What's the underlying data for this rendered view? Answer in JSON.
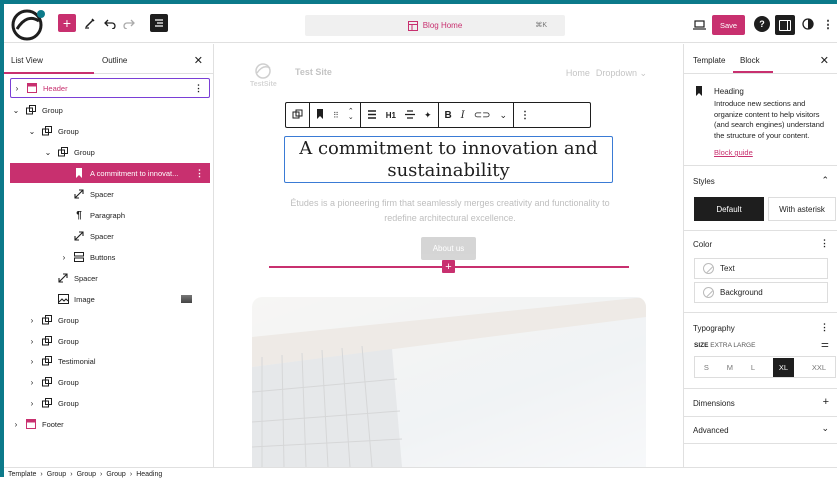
{
  "toolbar": {
    "document_title": "Blog Home",
    "shortcut": "⌘K",
    "save_label": "Save"
  },
  "left_panel": {
    "tabs": [
      "List View",
      "Outline"
    ],
    "tree": [
      {
        "label": "Header",
        "depth": 0,
        "chevron": "›",
        "icon": "template-part-icon"
      },
      {
        "label": "Group",
        "depth": 0,
        "chevron": "⌄",
        "icon": "group-icon"
      },
      {
        "label": "Group",
        "depth": 1,
        "chevron": "⌄",
        "icon": "group-icon"
      },
      {
        "label": "Group",
        "depth": 2,
        "chevron": "⌄",
        "icon": "group-icon"
      },
      {
        "label": "A commitment to innovat...",
        "depth": 3,
        "chevron": "",
        "icon": "bookmark-icon"
      },
      {
        "label": "Spacer",
        "depth": 3,
        "chevron": "",
        "icon": "spacer-icon"
      },
      {
        "label": "Paragraph",
        "depth": 3,
        "chevron": "",
        "icon": "paragraph-icon"
      },
      {
        "label": "Spacer",
        "depth": 3,
        "chevron": "",
        "icon": "spacer-icon"
      },
      {
        "label": "Buttons",
        "depth": 3,
        "chevron": "›",
        "icon": "buttons-icon"
      },
      {
        "label": "Spacer",
        "depth": 2,
        "chevron": "",
        "icon": "spacer-icon"
      },
      {
        "label": "Image",
        "depth": 2,
        "chevron": "",
        "icon": "image-icon"
      },
      {
        "label": "Group",
        "depth": 1,
        "chevron": "›",
        "icon": "group-icon"
      },
      {
        "label": "Group",
        "depth": 1,
        "chevron": "›",
        "icon": "group-icon"
      },
      {
        "label": "Testimonial",
        "depth": 1,
        "chevron": "›",
        "icon": "group-icon"
      },
      {
        "label": "Group",
        "depth": 1,
        "chevron": "›",
        "icon": "group-icon"
      },
      {
        "label": "Group",
        "depth": 1,
        "chevron": "›",
        "icon": "group-icon"
      },
      {
        "label": "Footer",
        "depth": 0,
        "chevron": "›",
        "icon": "template-part-icon"
      }
    ]
  },
  "canvas": {
    "site_title": "Test Site",
    "site_logo_text": "TestSite",
    "nav": [
      "Home",
      "Dropdown ⌄"
    ],
    "heading_level": "H1",
    "heading": "A commitment to innovation and sustainability",
    "paragraph": "Études is a pioneering firm that seamlessly merges creativity and functionality to redefine architectural excellence.",
    "button_label": "About us"
  },
  "right_panel": {
    "tabs": [
      "Template",
      "Block"
    ],
    "block_name": "Heading",
    "block_description": "Introduce new sections and organize content to help visitors (and search engines) understand the structure of your content.",
    "block_guide": "Block guide",
    "styles_title": "Styles",
    "style_options": [
      "Default",
      "With asterisk"
    ],
    "color_title": "Color",
    "color_items": [
      "Text",
      "Background"
    ],
    "typography_title": "Typography",
    "size_label": "SIZE",
    "size_value": "EXTRA LARGE",
    "sizes": [
      "S",
      "M",
      "L",
      "XL",
      "XXL"
    ],
    "dimensions_title": "Dimensions",
    "advanced_title": "Advanced"
  },
  "breadcrumb": [
    "Template",
    "Group",
    "Group",
    "Group",
    "Heading"
  ],
  "colors": {
    "accent": "#c8306f",
    "frame": "#0c7a8a",
    "selection": "#3a7bd5"
  }
}
